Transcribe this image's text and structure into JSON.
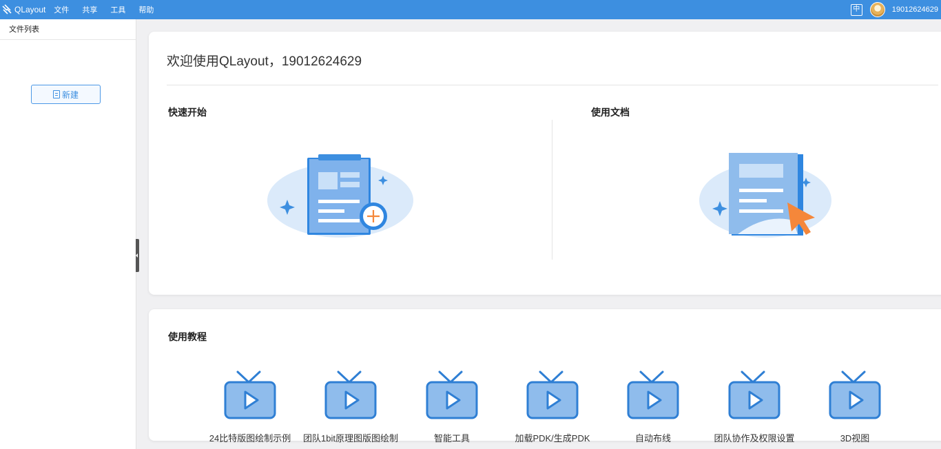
{
  "app": {
    "name": "QLayout"
  },
  "menu": {
    "items": [
      "文件",
      "共享",
      "工具",
      "帮助"
    ]
  },
  "topbar": {
    "lang_label": "中",
    "username": "19012624629"
  },
  "sidebar": {
    "title": "文件列表",
    "new_button": "新建"
  },
  "welcome": {
    "title": "欢迎使用QLayout，19012624629"
  },
  "quick_start": {
    "title": "快速开始"
  },
  "docs": {
    "title": "使用文档"
  },
  "tutorials": {
    "title": "使用教程",
    "items": [
      "24比特版图绘制示例",
      "团队1bit原理图版图绘制",
      "智能工具",
      "加载PDK/生成PDK",
      "自动布线",
      "团队协作及权限设置",
      "3D视图"
    ]
  },
  "colors": {
    "accent": "#3d8fe0",
    "illustration_light": "#dbeafa",
    "illustration_mid": "#8fbcec",
    "orange": "#f5873a"
  }
}
